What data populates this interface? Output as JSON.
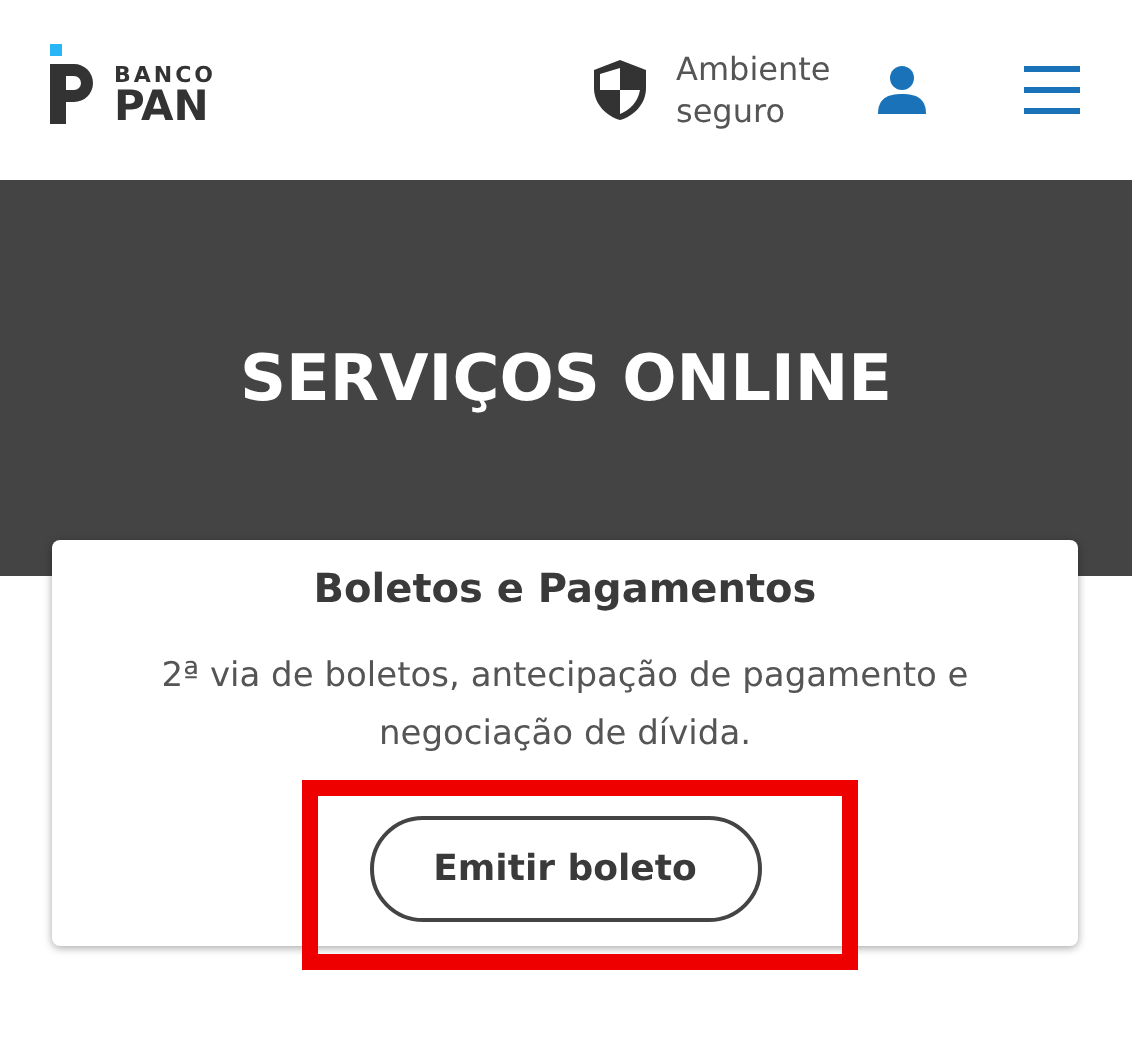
{
  "header": {
    "logo": {
      "line_1": "BANCO",
      "line_2": "PAN"
    },
    "secure_label": "Ambiente seguro"
  },
  "banner": {
    "title": "SERVIÇOS ONLINE"
  },
  "card": {
    "title": "Boletos e Pagamentos",
    "description": "2ª via de boletos, antecipação de pagamento e negociação de dívida.",
    "button": "Emitir boleto",
    "highlighted": true
  }
}
